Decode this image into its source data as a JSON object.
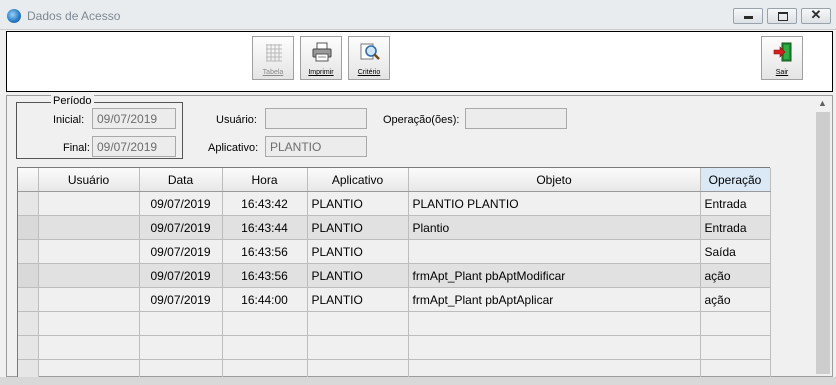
{
  "window": {
    "title": "Dados de Acesso",
    "close_glyph": "✕"
  },
  "toolbar": {
    "tabela_label": "Tabela",
    "imprimir_label": "Imprimir",
    "criterio_label": "Critério",
    "sair_label": "Sair"
  },
  "filters": {
    "periodo_label": "Período",
    "inicial_label": "Inicial:",
    "inicial_value": "09/07/2019",
    "final_label": "Final:",
    "final_value": "09/07/2019",
    "usuario_label": "Usuário:",
    "usuario_value": "",
    "aplicativo_label": "Aplicativo:",
    "aplicativo_value": "PLANTIO",
    "operacoes_label": "Operação(ões):",
    "operacoes_value": ""
  },
  "table": {
    "columns": [
      "Usuário",
      "Data",
      "Hora",
      "Aplicativo",
      "Objeto",
      "Operação"
    ],
    "rows": [
      {
        "usuario": "",
        "data": "09/07/2019",
        "hora": "16:43:42",
        "aplicativo": "PLANTIO",
        "objeto": "PLANTIO PLANTIO",
        "operacao": "Entrada"
      },
      {
        "usuario": "",
        "data": "09/07/2019",
        "hora": "16:43:44",
        "aplicativo": "PLANTIO",
        "objeto": "Plantio",
        "operacao": "Entrada"
      },
      {
        "usuario": "",
        "data": "09/07/2019",
        "hora": "16:43:56",
        "aplicativo": "PLANTIO",
        "objeto": "",
        "operacao": "Saída"
      },
      {
        "usuario": "",
        "data": "09/07/2019",
        "hora": "16:43:56",
        "aplicativo": "PLANTIO",
        "objeto": "frmApt_Plant pbAptModificar",
        "operacao": " ação"
      },
      {
        "usuario": "",
        "data": "09/07/2019",
        "hora": "16:44:00",
        "aplicativo": "PLANTIO",
        "objeto": "frmApt_Plant pbAptAplicar",
        "operacao": " ação"
      },
      {
        "usuario": "",
        "data": "",
        "hora": "",
        "aplicativo": "",
        "objeto": "",
        "operacao": ""
      },
      {
        "usuario": "",
        "data": "",
        "hora": "",
        "aplicativo": "",
        "objeto": "",
        "operacao": ""
      },
      {
        "usuario": "",
        "data": "",
        "hora": "",
        "aplicativo": "",
        "objeto": "",
        "operacao": ""
      }
    ]
  },
  "icons": {
    "app": "app-globe-icon",
    "tabela": "grid-table-icon",
    "imprimir": "printer-icon",
    "criterio": "magnifier-icon",
    "sair": "exit-door-icon",
    "scroll_up": "chevron-up-icon"
  },
  "colors": {
    "alt_row": "#e1e1e1",
    "header_selected": "#dbe9f7",
    "exit_red": "#d42020",
    "exit_green": "#1f8a2e"
  }
}
